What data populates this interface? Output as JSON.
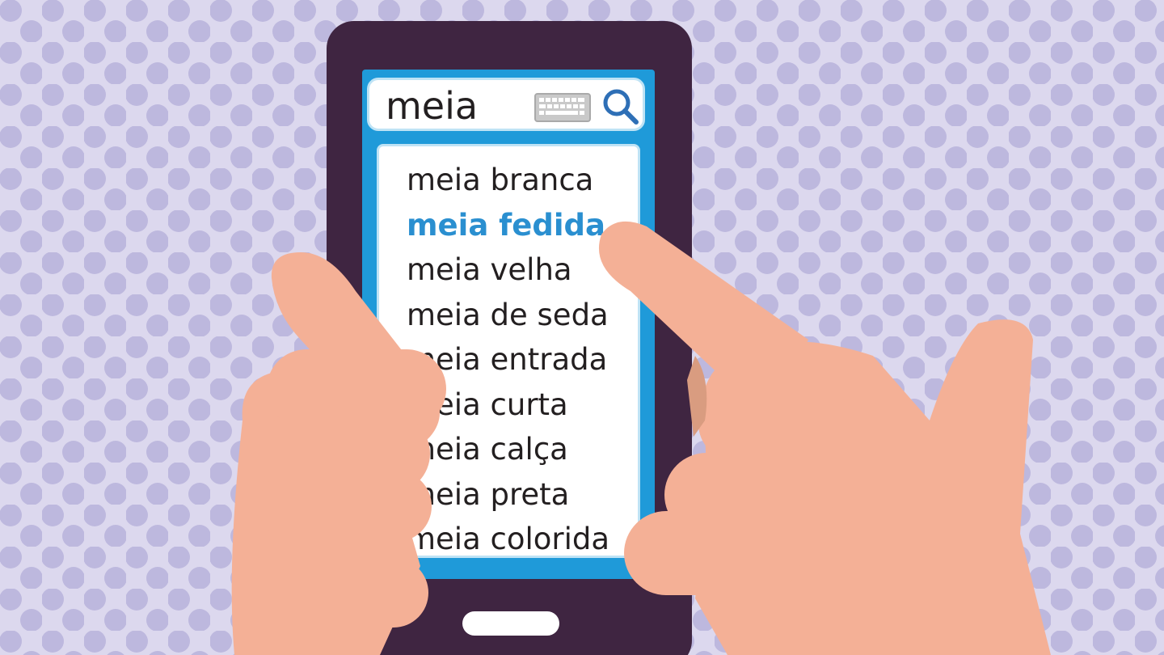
{
  "search": {
    "query": "meia",
    "keyboard_icon": "keyboard-icon",
    "search_icon": "magnifier-icon"
  },
  "suggestions": [
    {
      "label": "meia branca",
      "highlighted": false
    },
    {
      "label": "meia fedida",
      "highlighted": true
    },
    {
      "label": "meia velha",
      "highlighted": false
    },
    {
      "label": "meia de seda",
      "highlighted": false
    },
    {
      "label": "meia entrada",
      "highlighted": false
    },
    {
      "label": "meia curta",
      "highlighted": false
    },
    {
      "label": "meia calça",
      "highlighted": false
    },
    {
      "label": "meia preta",
      "highlighted": false
    },
    {
      "label": "meia colorida",
      "highlighted": false
    }
  ],
  "colors": {
    "background": "#dcd8ee",
    "dots": "#bdb8de",
    "phone_body": "#3f2541",
    "screen": "#1f9ad9",
    "highlight_text": "#2a8fd0",
    "skin": "#f4b096"
  }
}
